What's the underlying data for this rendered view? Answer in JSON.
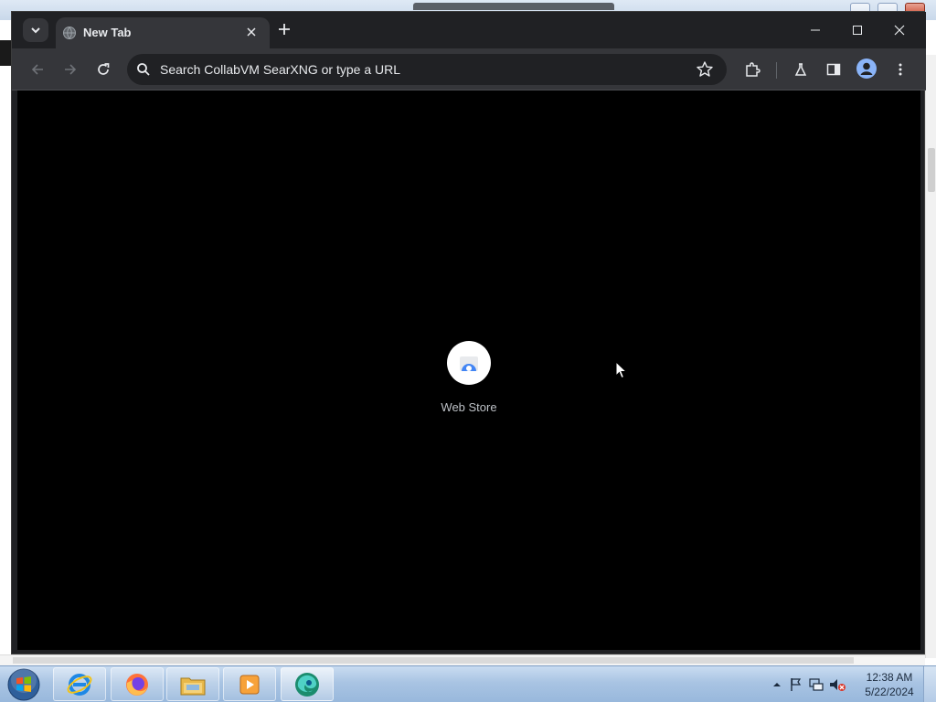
{
  "browser": {
    "tab": {
      "title": "New Tab"
    },
    "omnibox": {
      "placeholder": "Search CollabVM SearXNG or type a URL"
    },
    "shortcuts": [
      {
        "label": "Web Store"
      }
    ]
  },
  "taskbar": {
    "apps": [
      {
        "name": "internet-explorer-icon"
      },
      {
        "name": "firefox-icon"
      },
      {
        "name": "file-explorer-icon"
      },
      {
        "name": "media-player-icon"
      },
      {
        "name": "edge-icon"
      }
    ],
    "clock": {
      "time": "12:38 AM",
      "date": "5/22/2024"
    }
  },
  "colors": {
    "chrome_frame": "#202124",
    "chrome_toolbar": "#35363a",
    "page_bg": "#000000",
    "taskbar": "#a9c4e3"
  }
}
